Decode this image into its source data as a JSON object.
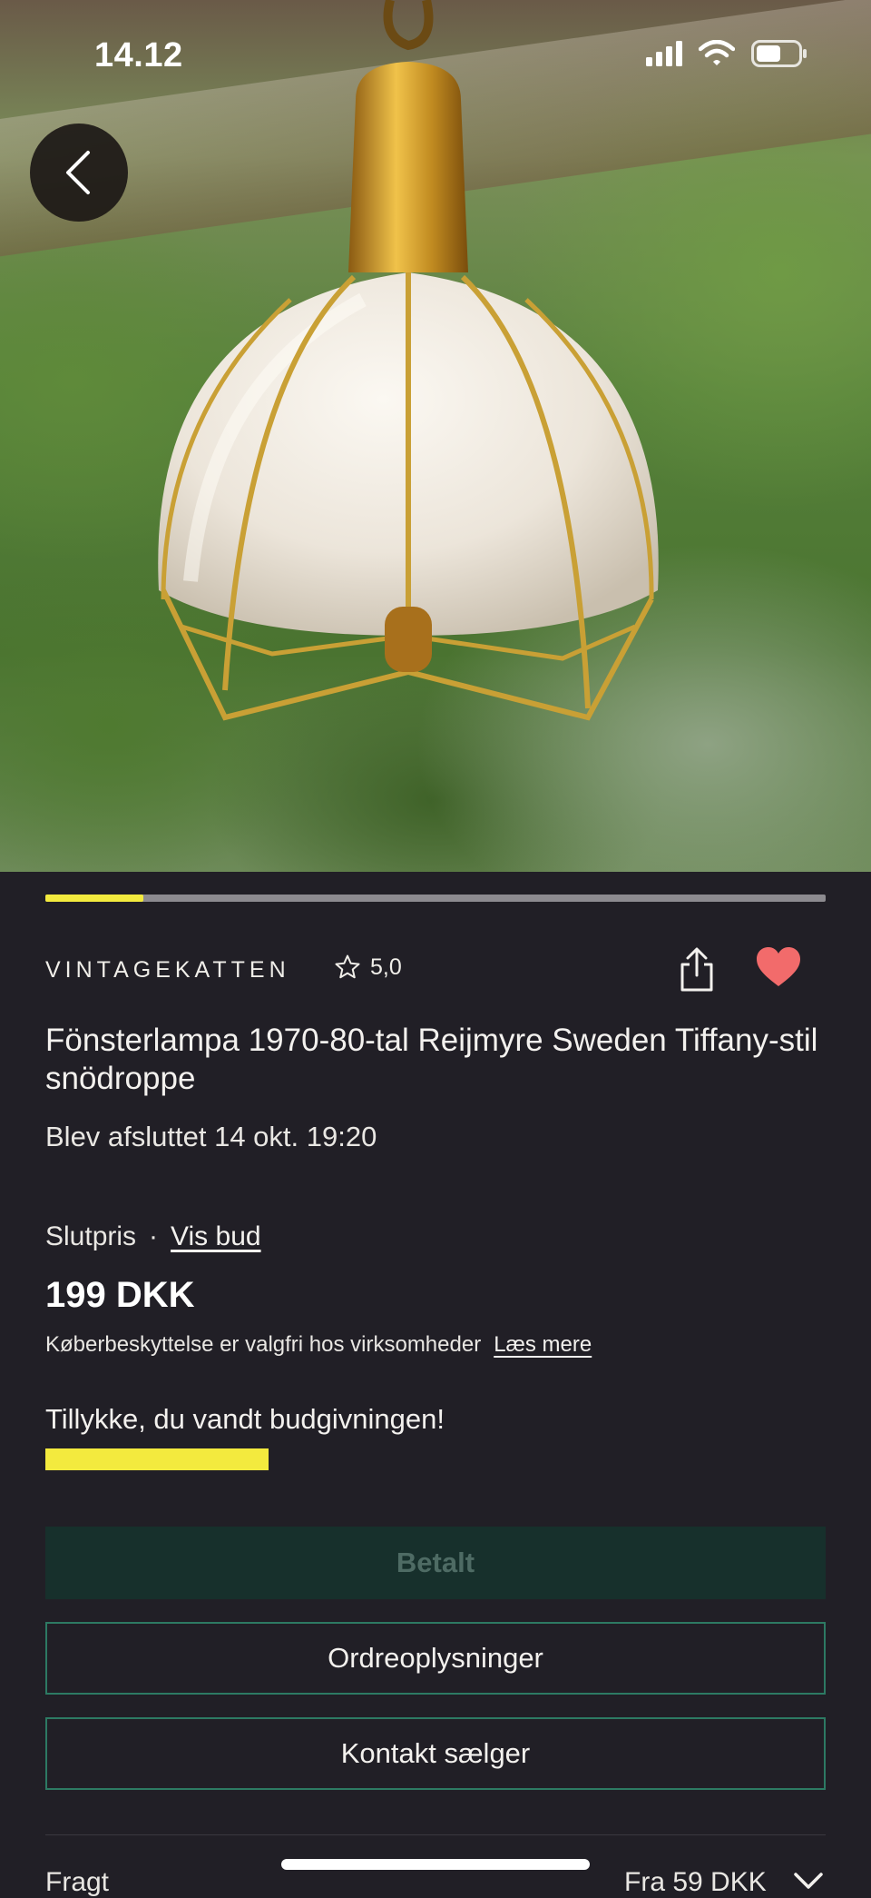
{
  "status_bar": {
    "time": "14.12",
    "battery_level": 0.6
  },
  "gallery": {
    "image_index": 1,
    "image_count": 8
  },
  "seller": {
    "name": "VINTAGEKATTEN",
    "rating": "5,0"
  },
  "listing": {
    "title": "Fönsterlampa 1970-80-tal Reijmyre Sweden Tiffany-stil snödroppe",
    "ended": "Blev afsluttet 14 okt. 19:20",
    "final_price_label": "Slutpris",
    "separator": "·",
    "view_bids_label": "Vis bud",
    "price": "199 DKK",
    "protection_text": "Køberbeskyttelse er valgfri hos virksomheder",
    "read_more_label": "Læs mere",
    "win_message": "Tillykke, du vandt budgivningen!"
  },
  "actions": {
    "paid_label": "Betalt",
    "order_info_label": "Ordreoplysninger",
    "contact_seller_label": "Kontakt sælger"
  },
  "freight": {
    "label": "Fragt",
    "value": "Fra 59 DKK"
  },
  "colors": {
    "background": "#211f26",
    "accent_yellow": "#f3ea3e",
    "favorite": "#f26b6b",
    "button_border": "#2d7a63",
    "paid_button_bg": "#17302c"
  },
  "icons": [
    "back-arrow-icon",
    "star-icon",
    "share-icon",
    "heart-icon",
    "chevron-down-icon",
    "signal-icon",
    "wifi-icon",
    "battery-icon"
  ]
}
